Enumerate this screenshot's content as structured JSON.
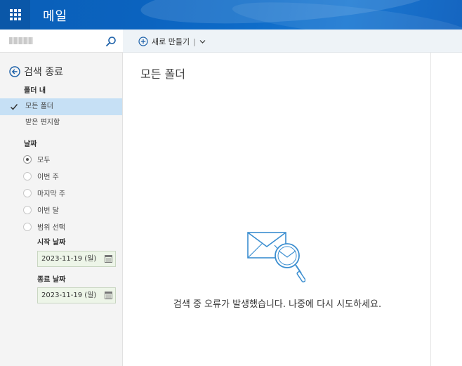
{
  "header": {
    "title": "메일",
    "waffle_icon": "waffle-icon"
  },
  "left_pane": {
    "search": {
      "icon": "search-icon"
    },
    "exit_search_label": "검색 종료",
    "folders_section_label": "폴더 내",
    "folders": [
      {
        "label": "모든 폴더",
        "selected": true
      },
      {
        "label": "받은 편지함",
        "selected": false
      }
    ],
    "date_section_label": "날짜",
    "date_options": [
      {
        "label": "모두",
        "checked": true
      },
      {
        "label": "이번 주",
        "checked": false
      },
      {
        "label": "마지막 주",
        "checked": false
      },
      {
        "label": "이번 달",
        "checked": false
      },
      {
        "label": "범위 선택",
        "checked": false
      }
    ],
    "start_date_label": "시작 날짜",
    "start_date_value": "2023-11-19 (일)",
    "end_date_label": "종료 날짜",
    "end_date_value": "2023-11-19 (일)"
  },
  "toolbar": {
    "new_label": "새로 만들기",
    "separator": "|"
  },
  "message_list": {
    "title": "모든 폴더",
    "error_message": "검색 중 오류가 발생했습니다. 나중에 다시 시도하세요."
  },
  "colors": {
    "header_blue": "#0b63bf",
    "selection": "#c6e0f5",
    "accent": "#1976d2"
  }
}
